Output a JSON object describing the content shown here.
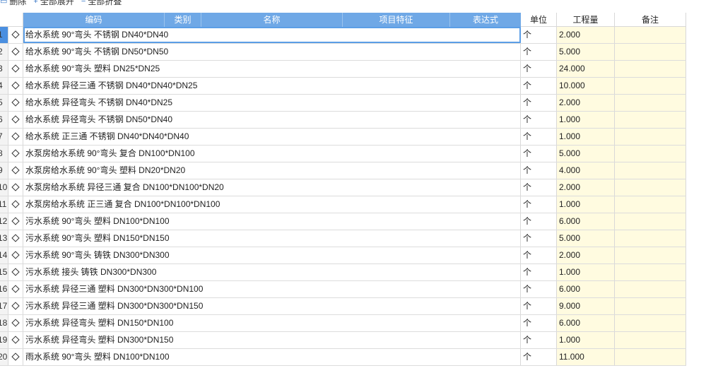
{
  "toolbar": {
    "items": [
      {
        "icon": "delete-icon",
        "label": "删除"
      },
      {
        "icon": "expand-icon",
        "label": "全部展开"
      },
      {
        "icon": "collapse-icon",
        "label": "全部折叠"
      }
    ]
  },
  "columns": {
    "code": "编码",
    "category": "类别",
    "name": "名称",
    "feature": "项目特征",
    "expr": "表达式",
    "unit": "单位",
    "qty": "工程量",
    "note": "备注"
  },
  "rows": [
    {
      "num": "1",
      "name": "给水系统  90°弯头 不锈钢 DN40*DN40",
      "unit": "个",
      "qty": "2.000",
      "note": ""
    },
    {
      "num": "2",
      "name": "给水系统  90°弯头 不锈钢 DN50*DN50",
      "unit": "个",
      "qty": "5.000",
      "note": ""
    },
    {
      "num": "3",
      "name": "给水系统  90°弯头 塑料 DN25*DN25",
      "unit": "个",
      "qty": "24.000",
      "note": ""
    },
    {
      "num": "4",
      "name": "给水系统  异径三通 不锈钢 DN40*DN40*DN25",
      "unit": "个",
      "qty": "10.000",
      "note": ""
    },
    {
      "num": "5",
      "name": "给水系统  异径弯头 不锈钢 DN40*DN25",
      "unit": "个",
      "qty": "2.000",
      "note": ""
    },
    {
      "num": "6",
      "name": "给水系统  异径弯头 不锈钢 DN50*DN40",
      "unit": "个",
      "qty": "1.000",
      "note": ""
    },
    {
      "num": "7",
      "name": "给水系统  正三通 不锈钢 DN40*DN40*DN40",
      "unit": "个",
      "qty": "1.000",
      "note": ""
    },
    {
      "num": "8",
      "name": "水泵房给水系统  90°弯头 复合 DN100*DN100",
      "unit": "个",
      "qty": "5.000",
      "note": ""
    },
    {
      "num": "9",
      "name": "水泵房给水系统  90°弯头 塑料 DN20*DN20",
      "unit": "个",
      "qty": "4.000",
      "note": ""
    },
    {
      "num": "10",
      "name": "水泵房给水系统  异径三通 复合 DN100*DN100*DN20",
      "unit": "个",
      "qty": "2.000",
      "note": ""
    },
    {
      "num": "11",
      "name": "水泵房给水系统  正三通 复合 DN100*DN100*DN100",
      "unit": "个",
      "qty": "1.000",
      "note": ""
    },
    {
      "num": "12",
      "name": "污水系统  90°弯头 塑料 DN100*DN100",
      "unit": "个",
      "qty": "6.000",
      "note": ""
    },
    {
      "num": "13",
      "name": "污水系统  90°弯头 塑料 DN150*DN150",
      "unit": "个",
      "qty": "5.000",
      "note": ""
    },
    {
      "num": "14",
      "name": "污水系统  90°弯头 铸铁 DN300*DN300",
      "unit": "个",
      "qty": "2.000",
      "note": ""
    },
    {
      "num": "15",
      "name": "污水系统  接头 铸铁 DN300*DN300",
      "unit": "个",
      "qty": "1.000",
      "note": ""
    },
    {
      "num": "16",
      "name": "污水系统  异径三通 塑料 DN300*DN300*DN100",
      "unit": "个",
      "qty": "6.000",
      "note": ""
    },
    {
      "num": "17",
      "name": "污水系统  异径三通 塑料 DN300*DN300*DN150",
      "unit": "个",
      "qty": "9.000",
      "note": ""
    },
    {
      "num": "18",
      "name": "污水系统  异径弯头 塑料 DN150*DN100",
      "unit": "个",
      "qty": "6.000",
      "note": ""
    },
    {
      "num": "19",
      "name": "污水系统  异径弯头 塑料 DN300*DN150",
      "unit": "个",
      "qty": "1.000",
      "note": ""
    },
    {
      "num": "20",
      "name": "雨水系统  90°弯头 塑料 DN100*DN100",
      "unit": "个",
      "qty": "11.000",
      "note": ""
    }
  ],
  "selected_row": 0,
  "colors": {
    "header_blue": "#6fa8e6",
    "qty_bg": "#fffbe0",
    "selection": "#5b9ee6"
  }
}
